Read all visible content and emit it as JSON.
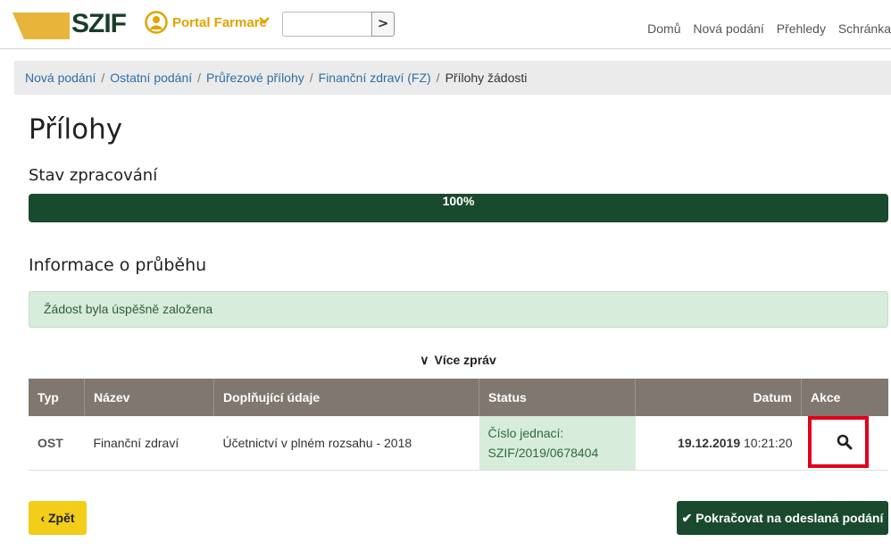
{
  "header": {
    "logo_text": "SZIF",
    "portal_label": "Portal Farmare",
    "search": {
      "value": "",
      "button": ">"
    },
    "nav": [
      "Domů",
      "Nová podání",
      "Přehledy",
      "Schránka"
    ]
  },
  "breadcrumb": {
    "links": [
      "Nová podání",
      "Ostatní podání",
      "Průřezové přílohy",
      "Finanční zdraví (FZ)"
    ],
    "current": "Přílohy žádosti",
    "separator": "/"
  },
  "page_title": "Přílohy",
  "progress": {
    "heading": "Stav zpracování",
    "value": 100,
    "label": "100%"
  },
  "info": {
    "heading": "Informace o průběhu",
    "alert": "Žádost byla úspěšně založena",
    "more_label": "Více zpráv"
  },
  "table": {
    "columns": [
      "Typ",
      "Název",
      "Doplňující údaje",
      "Status",
      "Datum",
      "Akce"
    ],
    "rows": [
      {
        "typ": "OST",
        "nazev": "Finanční zdraví",
        "doplnujici": "Účetnictví v plném rozsahu - 2018",
        "status_line1": "Číslo jednací:",
        "status_line2": "SZIF/2019/0678404",
        "datum_date": "19.12.2019",
        "datum_time": "10:21:20"
      }
    ]
  },
  "buttons": {
    "back": "Zpět",
    "continue": "Pokračovat na odeslaná podání"
  },
  "colors": {
    "brand_green": "#1a4a2e",
    "brand_yellow": "#f2cd1a",
    "highlight_red": "#e0001b"
  }
}
